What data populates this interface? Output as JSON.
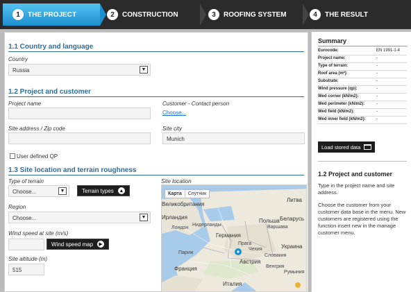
{
  "steps": [
    {
      "num": "1",
      "label": "THE PROJECT"
    },
    {
      "num": "2",
      "label": "CONSTRUCTION"
    },
    {
      "num": "3",
      "label": "ROOFING SYSTEM"
    },
    {
      "num": "4",
      "label": "THE RESULT"
    }
  ],
  "sec1": {
    "title": "1.1 Country and language",
    "country_label": "Country",
    "country_value": "Russia"
  },
  "sec2": {
    "title": "1.2 Project and customer",
    "project_name_label": "Project name",
    "project_name_value": "",
    "customer_label": "Customer - Contact person",
    "choose_link": "Choose...",
    "site_address_label": "Site address / Zip code",
    "site_address_value": "",
    "site_city_label": "Site city",
    "site_city_value": "Munich",
    "user_qp_label": "User defined QP"
  },
  "sec3": {
    "title": "1.3 Site location and terrain roughness",
    "terrain_label": "Type of terrain",
    "terrain_value": "Choose...",
    "terrain_btn": "Terrain types",
    "region_label": "Region",
    "region_value": "Choose...",
    "wind_label": "Wind speed at site (m/s)",
    "wind_value": "",
    "wind_btn": "Wind speed map",
    "altitude_label": "Site altitude (m)",
    "altitude_value": "515",
    "site_location_label": "Site location"
  },
  "map": {
    "tab_map": "Карта",
    "tab_sat": "Спутник",
    "labels": [
      "Великобритания",
      "Литва",
      "Ирландия",
      "Беларусь",
      "Лондон",
      "Нидерланды",
      "Варшава",
      "Польша",
      "Германия",
      "Прага",
      "Чехия",
      "Украина",
      "Париж",
      "Словакия",
      "Австрия",
      "Франция",
      "Венгрия",
      "Румыния",
      "Италия"
    ]
  },
  "summary": {
    "title": "Summary",
    "rows": [
      {
        "k": "Eurocode:",
        "v": "EN 1991-1-4"
      },
      {
        "k": "Project name:",
        "v": "-"
      },
      {
        "k": "Type of terrain:",
        "v": "-"
      },
      {
        "k": "Roof area (m²):",
        "v": "-"
      },
      {
        "k": "Substrate:",
        "v": "-"
      },
      {
        "k": "Wind pressure (qp):",
        "v": "-"
      },
      {
        "k": "Wed corner (kN/m2):",
        "v": "-"
      },
      {
        "k": "Wed perimeter (kN/m2):",
        "v": "-"
      },
      {
        "k": "Wed field (kN/m2):",
        "v": "-"
      },
      {
        "k": "Wed inner field (kN/m2):",
        "v": "-"
      }
    ],
    "load_btn": "Load stored data"
  },
  "help": {
    "title": "1.2 Project and customer",
    "p1": "Type in the project name and site address.",
    "p2": "Choose the customer from your customer data base in the menu. New customers are registered using the function insert new in the manage customer menu."
  },
  "colors": {
    "accent": "#2d6e9e",
    "step_active": "#1c8fd0"
  }
}
